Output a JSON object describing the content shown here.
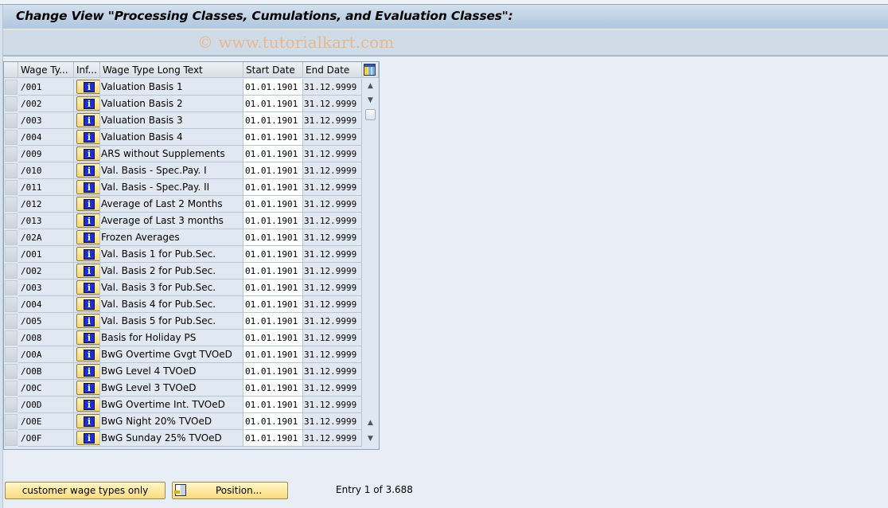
{
  "header": {
    "title": "Change View \"Processing Classes, Cumulations, and Evaluation Classes\":",
    "watermark": "© www.tutorialkart.com"
  },
  "table": {
    "columns": {
      "wage_type": "Wage Ty...",
      "info": "Inf...",
      "long_text": "Wage Type Long Text",
      "start_date": "Start Date",
      "end_date": "End Date"
    },
    "info_icon": "i",
    "rows": [
      {
        "wage_type": "/001",
        "long_text": "Valuation Basis 1",
        "start_date": "01.01.1901",
        "end_date": "31.12.9999"
      },
      {
        "wage_type": "/002",
        "long_text": "Valuation Basis 2",
        "start_date": "01.01.1901",
        "end_date": "31.12.9999"
      },
      {
        "wage_type": "/003",
        "long_text": "Valuation Basis 3",
        "start_date": "01.01.1901",
        "end_date": "31.12.9999"
      },
      {
        "wage_type": "/004",
        "long_text": "Valuation Basis 4",
        "start_date": "01.01.1901",
        "end_date": "31.12.9999"
      },
      {
        "wage_type": "/009",
        "long_text": "ARS without Supplements",
        "start_date": "01.01.1901",
        "end_date": "31.12.9999"
      },
      {
        "wage_type": "/010",
        "long_text": "Val. Basis - Spec.Pay. I",
        "start_date": "01.01.1901",
        "end_date": "31.12.9999"
      },
      {
        "wage_type": "/011",
        "long_text": "Val. Basis - Spec.Pay. II",
        "start_date": "01.01.1901",
        "end_date": "31.12.9999"
      },
      {
        "wage_type": "/012",
        "long_text": "Average of Last 2 Months",
        "start_date": "01.01.1901",
        "end_date": "31.12.9999"
      },
      {
        "wage_type": "/013",
        "long_text": "Average of Last 3 months",
        "start_date": "01.01.1901",
        "end_date": "31.12.9999"
      },
      {
        "wage_type": "/02A",
        "long_text": "Frozen Averages",
        "start_date": "01.01.1901",
        "end_date": "31.12.9999"
      },
      {
        "wage_type": "/O01",
        "long_text": "Val. Basis 1 for Pub.Sec.",
        "start_date": "01.01.1901",
        "end_date": "31.12.9999"
      },
      {
        "wage_type": "/O02",
        "long_text": "Val. Basis 2 for Pub.Sec.",
        "start_date": "01.01.1901",
        "end_date": "31.12.9999"
      },
      {
        "wage_type": "/O03",
        "long_text": "Val. Basis 3 for Pub.Sec.",
        "start_date": "01.01.1901",
        "end_date": "31.12.9999"
      },
      {
        "wage_type": "/O04",
        "long_text": "Val. Basis 4 for Pub.Sec.",
        "start_date": "01.01.1901",
        "end_date": "31.12.9999"
      },
      {
        "wage_type": "/O05",
        "long_text": "Val. Basis 5 for Pub.Sec.",
        "start_date": "01.01.1901",
        "end_date": "31.12.9999"
      },
      {
        "wage_type": "/O08",
        "long_text": "Basis for Holiday PS",
        "start_date": "01.01.1901",
        "end_date": "31.12.9999"
      },
      {
        "wage_type": "/O0A",
        "long_text": "BwG Overtime Gvgt TVOeD",
        "start_date": "01.01.1901",
        "end_date": "31.12.9999"
      },
      {
        "wage_type": "/O0B",
        "long_text": "BwG Level 4 TVOeD",
        "start_date": "01.01.1901",
        "end_date": "31.12.9999"
      },
      {
        "wage_type": "/O0C",
        "long_text": "BwG Level 3 TVOeD",
        "start_date": "01.01.1901",
        "end_date": "31.12.9999"
      },
      {
        "wage_type": "/O0D",
        "long_text": "BwG Overtime Int. TVOeD",
        "start_date": "01.01.1901",
        "end_date": "31.12.9999"
      },
      {
        "wage_type": "/O0E",
        "long_text": "BwG Night 20% TVOeD",
        "start_date": "01.01.1901",
        "end_date": "31.12.9999"
      },
      {
        "wage_type": "/O0F",
        "long_text": "BwG Sunday 25% TVOeD",
        "start_date": "01.01.1901",
        "end_date": "31.12.9999"
      }
    ],
    "scroll_up_glyph": "▲",
    "scroll_down_glyph": "▼"
  },
  "footer": {
    "customer_button": "customer wage types only",
    "position_button": "Position...",
    "entry_text": "Entry 1 of 3.688"
  }
}
